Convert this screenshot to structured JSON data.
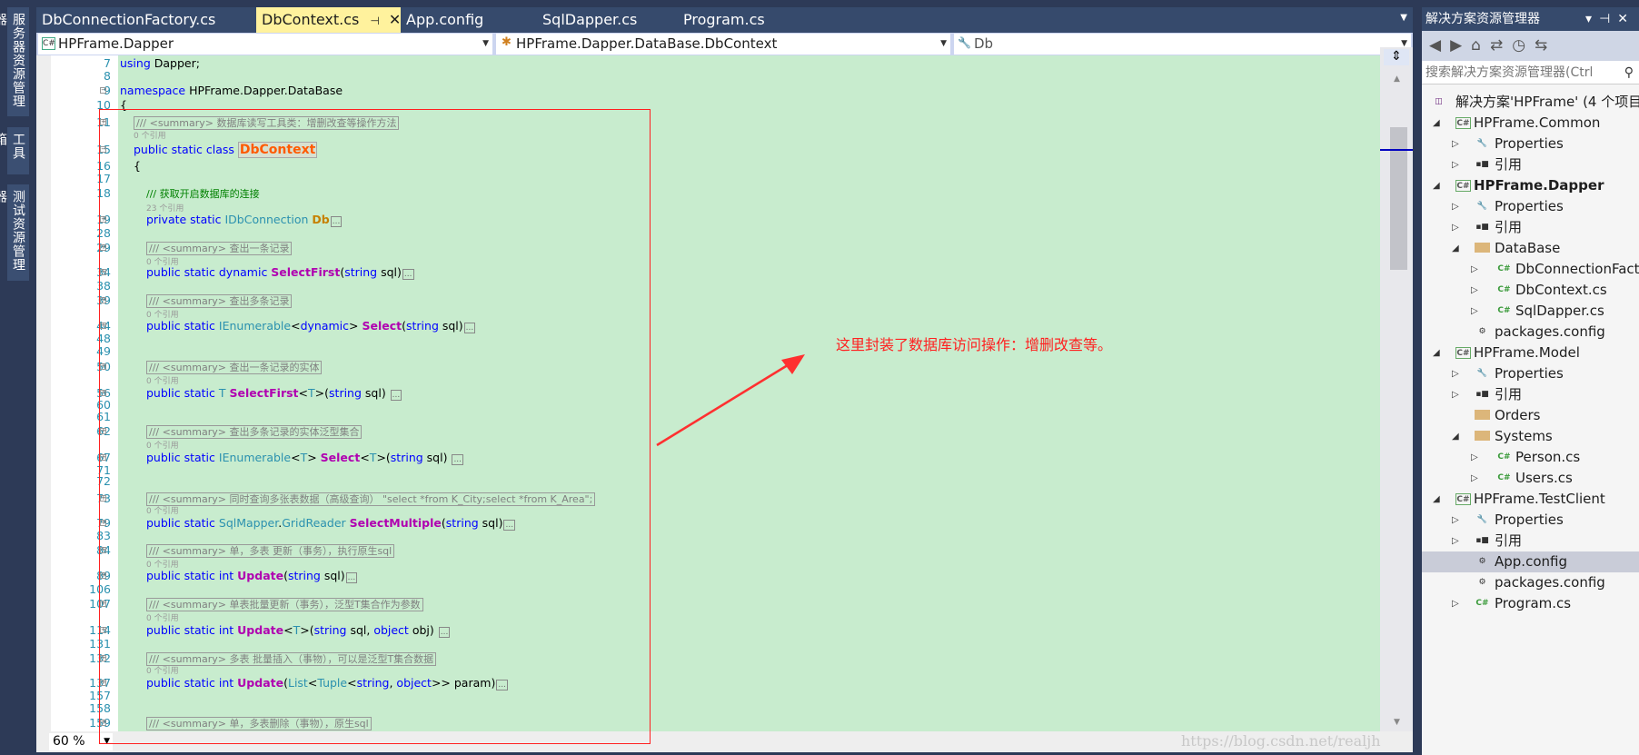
{
  "left_toolbar": [
    "服务器资源管理器",
    "工具箱",
    "测试资源管理器"
  ],
  "tabs": [
    {
      "label": "DbConnectionFactory.cs"
    },
    {
      "label": "DbContext.cs",
      "active": true,
      "pin": "pin-icon",
      "close": "✕"
    },
    {
      "label": "App.config"
    },
    {
      "label": "SqlDapper.cs"
    },
    {
      "label": "Program.cs"
    }
  ],
  "nav": {
    "project": "HPFrame.Dapper",
    "type": "HPFrame.Dapper.DataBase.DbContext",
    "member": "Db"
  },
  "code_rows": [
    {
      "n": "7",
      "tokens": [
        [
          "k",
          "using"
        ],
        [
          "p",
          " Dapper;"
        ]
      ]
    },
    {
      "n": "8",
      "tokens": []
    },
    {
      "n": "9",
      "tokens": [
        [
          "k",
          "namespace"
        ],
        [
          "p",
          " HPFrame.Dapper.DataBase"
        ]
      ]
    },
    {
      "n": "10",
      "tokens": [
        [
          "p",
          "{"
        ]
      ]
    },
    {
      "n": "11",
      "tokens": [
        [
          "s",
          "/// <summary> 数据库读写工具类：增删改查等操作方法"
        ]
      ]
    },
    {
      "n": "",
      "tokens": [
        [
          "r",
          "0 个引用"
        ]
      ]
    },
    {
      "n": "15",
      "tokens": [
        [
          "k",
          "public static class "
        ],
        [
          "c",
          "DbContext"
        ]
      ]
    },
    {
      "n": "16",
      "tokens": [
        [
          "p",
          "{"
        ]
      ]
    },
    {
      "n": "17",
      "tokens": []
    },
    {
      "n": "18",
      "tokens": [
        [
          "g",
          "/// 获取开启数据库的连接"
        ]
      ]
    },
    {
      "n": "",
      "tokens": [
        [
          "r",
          "23 个引用"
        ]
      ]
    },
    {
      "n": "19",
      "tokens": [
        [
          "k",
          "private static "
        ],
        [
          "t",
          "IDbConnection "
        ],
        [
          "f",
          "Db"
        ],
        [
          "e",
          "..."
        ]
      ]
    },
    {
      "n": "28",
      "tokens": []
    },
    {
      "n": "29",
      "tokens": [
        [
          "s",
          "/// <summary> 查出一条记录"
        ]
      ]
    },
    {
      "n": "",
      "tokens": [
        [
          "r",
          "0 个引用"
        ]
      ]
    },
    {
      "n": "34",
      "tokens": [
        [
          "k",
          "public static dynamic "
        ],
        [
          "m",
          "SelectFirst"
        ],
        [
          "p",
          "("
        ],
        [
          "k",
          "string"
        ],
        [
          "p",
          " sql)"
        ],
        [
          "e",
          "..."
        ]
      ]
    },
    {
      "n": "38",
      "tokens": []
    },
    {
      "n": "39",
      "tokens": [
        [
          "s",
          "/// <summary> 查出多条记录"
        ]
      ]
    },
    {
      "n": "",
      "tokens": [
        [
          "r",
          "0 个引用"
        ]
      ]
    },
    {
      "n": "44",
      "tokens": [
        [
          "k",
          "public static "
        ],
        [
          "t",
          "IEnumerable"
        ],
        [
          "p",
          "<"
        ],
        [
          "k",
          "dynamic"
        ],
        [
          "p",
          "> "
        ],
        [
          "m",
          "Select"
        ],
        [
          "p",
          "("
        ],
        [
          "k",
          "string"
        ],
        [
          "p",
          " sql)"
        ],
        [
          "e",
          "..."
        ]
      ]
    },
    {
      "n": "48",
      "tokens": []
    },
    {
      "n": "49",
      "tokens": []
    },
    {
      "n": "50",
      "tokens": [
        [
          "s",
          "/// <summary> 查出一条记录的实体"
        ]
      ]
    },
    {
      "n": "",
      "tokens": [
        [
          "r",
          "0 个引用"
        ]
      ]
    },
    {
      "n": "56",
      "tokens": [
        [
          "k",
          "public static "
        ],
        [
          "t",
          "T "
        ],
        [
          "m",
          "SelectFirst"
        ],
        [
          "p",
          "<"
        ],
        [
          "t",
          "T"
        ],
        [
          "p",
          ">("
        ],
        [
          "k",
          "string"
        ],
        [
          "p",
          " sql) "
        ],
        [
          "e",
          "..."
        ]
      ]
    },
    {
      "n": "60",
      "tokens": []
    },
    {
      "n": "61",
      "tokens": []
    },
    {
      "n": "62",
      "tokens": [
        [
          "s",
          "/// <summary> 查出多条记录的实体泛型集合"
        ]
      ]
    },
    {
      "n": "",
      "tokens": [
        [
          "r",
          "0 个引用"
        ]
      ]
    },
    {
      "n": "67",
      "tokens": [
        [
          "k",
          "public static "
        ],
        [
          "t",
          "IEnumerable"
        ],
        [
          "p",
          "<"
        ],
        [
          "t",
          "T"
        ],
        [
          "p",
          "> "
        ],
        [
          "m",
          "Select"
        ],
        [
          "p",
          "<"
        ],
        [
          "t",
          "T"
        ],
        [
          "p",
          ">("
        ],
        [
          "k",
          "string"
        ],
        [
          "p",
          " sql) "
        ],
        [
          "e",
          "..."
        ]
      ]
    },
    {
      "n": "71",
      "tokens": []
    },
    {
      "n": "72",
      "tokens": []
    },
    {
      "n": "73",
      "tokens": [
        [
          "s",
          "/// <summary> 同时查询多张表数据（高级查询） \"select *from K_City;select *from K_Area\";"
        ]
      ]
    },
    {
      "n": "",
      "tokens": [
        [
          "r",
          "0 个引用"
        ]
      ]
    },
    {
      "n": "79",
      "tokens": [
        [
          "k",
          "public static "
        ],
        [
          "t",
          "SqlMapper"
        ],
        [
          "p",
          "."
        ],
        [
          "t",
          "GridReader "
        ],
        [
          "m",
          "SelectMultiple"
        ],
        [
          "p",
          "("
        ],
        [
          "k",
          "string"
        ],
        [
          "p",
          " sql)"
        ],
        [
          "e",
          "..."
        ]
      ]
    },
    {
      "n": "83",
      "tokens": []
    },
    {
      "n": "84",
      "tokens": [
        [
          "s",
          "/// <summary> 单，多表 更新（事务），执行原生sql"
        ]
      ]
    },
    {
      "n": "",
      "tokens": [
        [
          "r",
          "0 个引用"
        ]
      ]
    },
    {
      "n": "89",
      "tokens": [
        [
          "k",
          "public static int "
        ],
        [
          "m",
          "Update"
        ],
        [
          "p",
          "("
        ],
        [
          "k",
          "string"
        ],
        [
          "p",
          " sql)"
        ],
        [
          "e",
          "..."
        ]
      ]
    },
    {
      "n": "106",
      "tokens": []
    },
    {
      "n": "107",
      "tokens": [
        [
          "s",
          "/// <summary> 单表批量更新（事务），泛型T集合作为参数"
        ]
      ]
    },
    {
      "n": "",
      "tokens": [
        [
          "r",
          "0 个引用"
        ]
      ]
    },
    {
      "n": "114",
      "tokens": [
        [
          "k",
          "public static int "
        ],
        [
          "m",
          "Update"
        ],
        [
          "p",
          "<"
        ],
        [
          "t",
          "T"
        ],
        [
          "p",
          ">("
        ],
        [
          "k",
          "string"
        ],
        [
          "p",
          " sql, "
        ],
        [
          "k",
          "object"
        ],
        [
          "p",
          " obj) "
        ],
        [
          "e",
          "..."
        ]
      ]
    },
    {
      "n": "131",
      "tokens": []
    },
    {
      "n": "132",
      "tokens": [
        [
          "s",
          "/// <summary> 多表 批量插入（事物），可以是泛型T集合数据"
        ]
      ]
    },
    {
      "n": "",
      "tokens": [
        [
          "r",
          "0 个引用"
        ]
      ]
    },
    {
      "n": "137",
      "tokens": [
        [
          "k",
          "public static int "
        ],
        [
          "m",
          "Update"
        ],
        [
          "p",
          "("
        ],
        [
          "t",
          "List"
        ],
        [
          "p",
          "<"
        ],
        [
          "t",
          "Tuple"
        ],
        [
          "p",
          "<"
        ],
        [
          "k",
          "string"
        ],
        [
          "p",
          ", "
        ],
        [
          "k",
          "object"
        ],
        [
          "p",
          ">> param)"
        ],
        [
          "e",
          "..."
        ]
      ]
    },
    {
      "n": "157",
      "tokens": []
    },
    {
      "n": "158",
      "tokens": []
    },
    {
      "n": "159",
      "tokens": [
        [
          "s",
          "/// <summary> 单，多表删除（事物），原生sql"
        ]
      ]
    }
  ],
  "annotation": {
    "text": "这里封装了数据库访问操作：增删改查等。",
    "color": "#ff2020"
  },
  "zoom": {
    "value": "60 %"
  },
  "solution_explorer": {
    "title": "解决方案资源管理器",
    "search_placeholder": "搜索解决方案资源管理器(Ctrl",
    "items": [
      {
        "level": 0,
        "exp": "none",
        "icon": "solution",
        "label": "解决方案'HPFrame' (4 个项目"
      },
      {
        "level": 1,
        "exp": "open",
        "icon": "csproj",
        "label": "HPFrame.Common"
      },
      {
        "level": 2,
        "exp": "closed",
        "icon": "wrench",
        "label": "Properties"
      },
      {
        "level": 2,
        "exp": "closed",
        "icon": "refs",
        "label": "引用"
      },
      {
        "level": 1,
        "exp": "open",
        "icon": "csproj",
        "label": "HPFrame.Dapper",
        "bold": true
      },
      {
        "level": 2,
        "exp": "closed",
        "icon": "wrench",
        "label": "Properties"
      },
      {
        "level": 2,
        "exp": "closed",
        "icon": "refs",
        "label": "引用"
      },
      {
        "level": 2,
        "exp": "open",
        "icon": "folder",
        "label": "DataBase"
      },
      {
        "level": 3,
        "exp": "closed",
        "icon": "cs",
        "label": "DbConnectionFactory.cs"
      },
      {
        "level": 3,
        "exp": "closed",
        "icon": "cs",
        "label": "DbContext.cs"
      },
      {
        "level": 3,
        "exp": "closed",
        "icon": "cs",
        "label": "SqlDapper.cs"
      },
      {
        "level": 2,
        "exp": "none",
        "icon": "config",
        "label": "packages.config"
      },
      {
        "level": 1,
        "exp": "open",
        "icon": "csproj",
        "label": "HPFrame.Model"
      },
      {
        "level": 2,
        "exp": "closed",
        "icon": "wrench",
        "label": "Properties"
      },
      {
        "level": 2,
        "exp": "closed",
        "icon": "refs",
        "label": "引用"
      },
      {
        "level": 2,
        "exp": "none",
        "icon": "folder",
        "label": "Orders"
      },
      {
        "level": 2,
        "exp": "open",
        "icon": "folder",
        "label": "Systems"
      },
      {
        "level": 3,
        "exp": "closed",
        "icon": "cs",
        "label": "Person.cs"
      },
      {
        "level": 3,
        "exp": "closed",
        "icon": "cs",
        "label": "Users.cs"
      },
      {
        "level": 1,
        "exp": "open",
        "icon": "csproj",
        "label": "HPFrame.TestClient"
      },
      {
        "level": 2,
        "exp": "closed",
        "icon": "wrench",
        "label": "Properties"
      },
      {
        "level": 2,
        "exp": "closed",
        "icon": "refs",
        "label": "引用"
      },
      {
        "level": 2,
        "exp": "none",
        "icon": "config",
        "label": "App.config",
        "selected": true
      },
      {
        "level": 2,
        "exp": "none",
        "icon": "config",
        "label": "packages.config"
      },
      {
        "level": 2,
        "exp": "closed",
        "icon": "cs",
        "label": "Program.cs"
      }
    ]
  },
  "watermark": "https://blog.csdn.net/realjh"
}
